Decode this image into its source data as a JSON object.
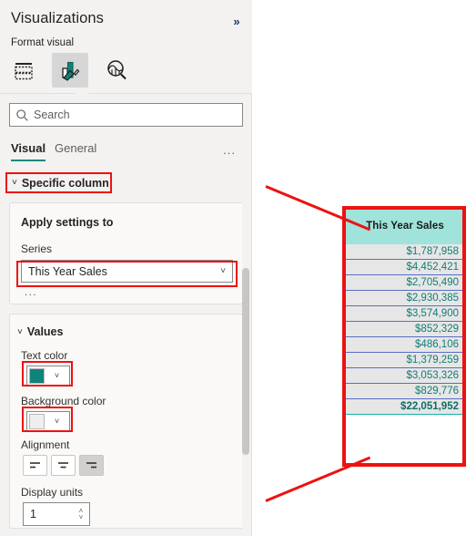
{
  "panel": {
    "title": "Visualizations",
    "collapse_icon": "chevron-double-right-icon",
    "format_label": "Format visual",
    "icon_tabs": [
      {
        "name": "build-visual-icon",
        "label": "Build visual"
      },
      {
        "name": "format-visual-icon",
        "label": "Format visual"
      },
      {
        "name": "analytics-icon",
        "label": "Analytics"
      }
    ],
    "search": {
      "placeholder": "Search",
      "value": "",
      "icon": "search-icon"
    },
    "tabs": [
      {
        "label": "Visual",
        "active": true
      },
      {
        "label": "General",
        "active": false
      }
    ],
    "tabs_overflow": "...",
    "section": {
      "label": "Specific column",
      "expanded": true,
      "chevron": "chevron-down-icon"
    },
    "cards": [
      {
        "title": "Apply settings to",
        "series_label": "Series",
        "series_value": "This Year Sales",
        "series_chevron": "chevron-down-icon",
        "overflow": "..."
      },
      {
        "title": "Values",
        "chevron": "chevron-down-icon",
        "text_color_label": "Text color",
        "text_color_value": "#0f8379",
        "background_color_label": "Background color",
        "background_color_value": "#eeeeee",
        "alignment_label": "Alignment",
        "alignment_options": [
          "align-left",
          "align-center",
          "align-right"
        ],
        "alignment_selected": "align-right",
        "display_units_label": "Display units",
        "display_units_value": "1"
      }
    ]
  },
  "highlights": {
    "color": "#ee1111",
    "boxes": [
      "specific-column",
      "series-dropdown",
      "text-color-picker",
      "background-color-picker",
      "table-column"
    ]
  },
  "table": {
    "header": "This Year Sales",
    "header_bg": "#9fe3db",
    "value_color": "#107d74",
    "row_bg": "#e6e6e6",
    "rows": [
      "$1,787,958",
      "$4,452,421",
      "$2,705,490",
      "$2,930,385",
      "$3,574,900",
      "$852,329",
      "$486,106",
      "$1,379,259",
      "$3,053,326",
      "$829,776"
    ],
    "total": "$22,051,952"
  }
}
